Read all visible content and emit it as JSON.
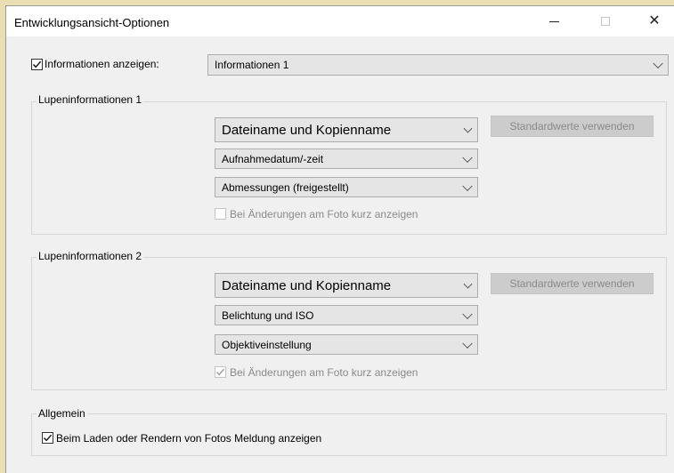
{
  "window": {
    "title": "Entwicklungsansicht-Optionen",
    "controls": {
      "minimize": "—",
      "maximize": "☐",
      "close": "✕"
    }
  },
  "top": {
    "show_info_label": "Informationen anzeigen:",
    "show_info_checked": true,
    "info_select_value": "Informationen 1"
  },
  "group1": {
    "title": "Lupeninformationen 1",
    "select1": "Dateiname und Kopienname",
    "select2": "Aufnahmedatum/-zeit",
    "select3": "Abmessungen (freigestellt)",
    "brief_label": "Bei Änderungen am Foto kurz anzeigen",
    "brief_checked": false,
    "defaults_button": "Standardwerte verwenden"
  },
  "group2": {
    "title": "Lupeninformationen 2",
    "select1": "Dateiname und Kopienname",
    "select2": "Belichtung und ISO",
    "select3": "Objektiveinstellung",
    "brief_label": "Bei Änderungen am Foto kurz anzeigen",
    "brief_checked": true,
    "defaults_button": "Standardwerte verwenden"
  },
  "general": {
    "title": "Allgemein",
    "loading_label": "Beim Laden oder Rendern von Fotos Meldung anzeigen",
    "loading_checked": true
  },
  "colors": {
    "desktop": "#e9dfb3",
    "dialog": "#f0f0f0",
    "select_bg": "#e5e5e5"
  }
}
